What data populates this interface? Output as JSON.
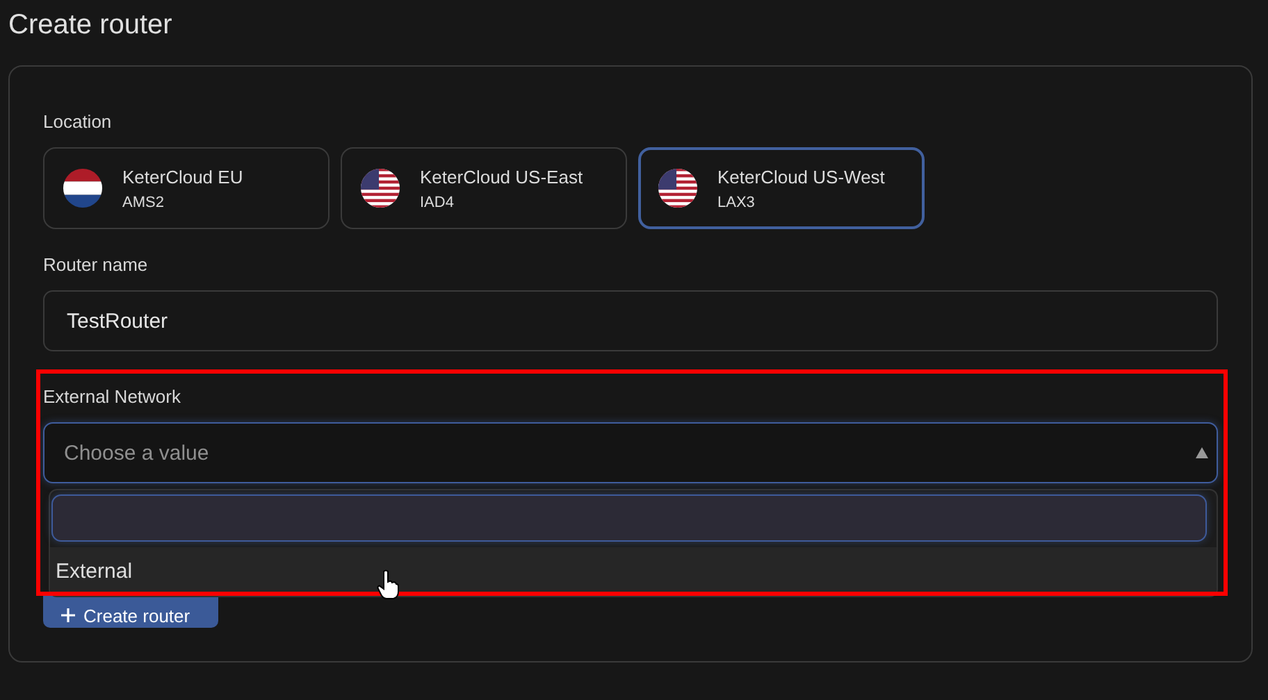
{
  "title": "Create router",
  "location": {
    "label": "Location",
    "options": [
      {
        "name": "KeterCloud EU",
        "code": "AMS2",
        "kind": "nl",
        "selected": false
      },
      {
        "name": "KeterCloud US-East",
        "code": "IAD4",
        "kind": "us",
        "selected": false
      },
      {
        "name": "KeterCloud US-West",
        "code": "LAX3",
        "kind": "us",
        "selected": true
      }
    ]
  },
  "router_name": {
    "label": "Router name",
    "value": "TestRouter"
  },
  "external_network": {
    "label": "External Network",
    "placeholder": "Choose a value",
    "expanded": true,
    "options": [
      {
        "label": "External",
        "hovered": true
      }
    ]
  },
  "create_button": {
    "label": "Create router"
  },
  "annotation": {
    "kind": "highlight",
    "color": "#ff0000"
  }
}
